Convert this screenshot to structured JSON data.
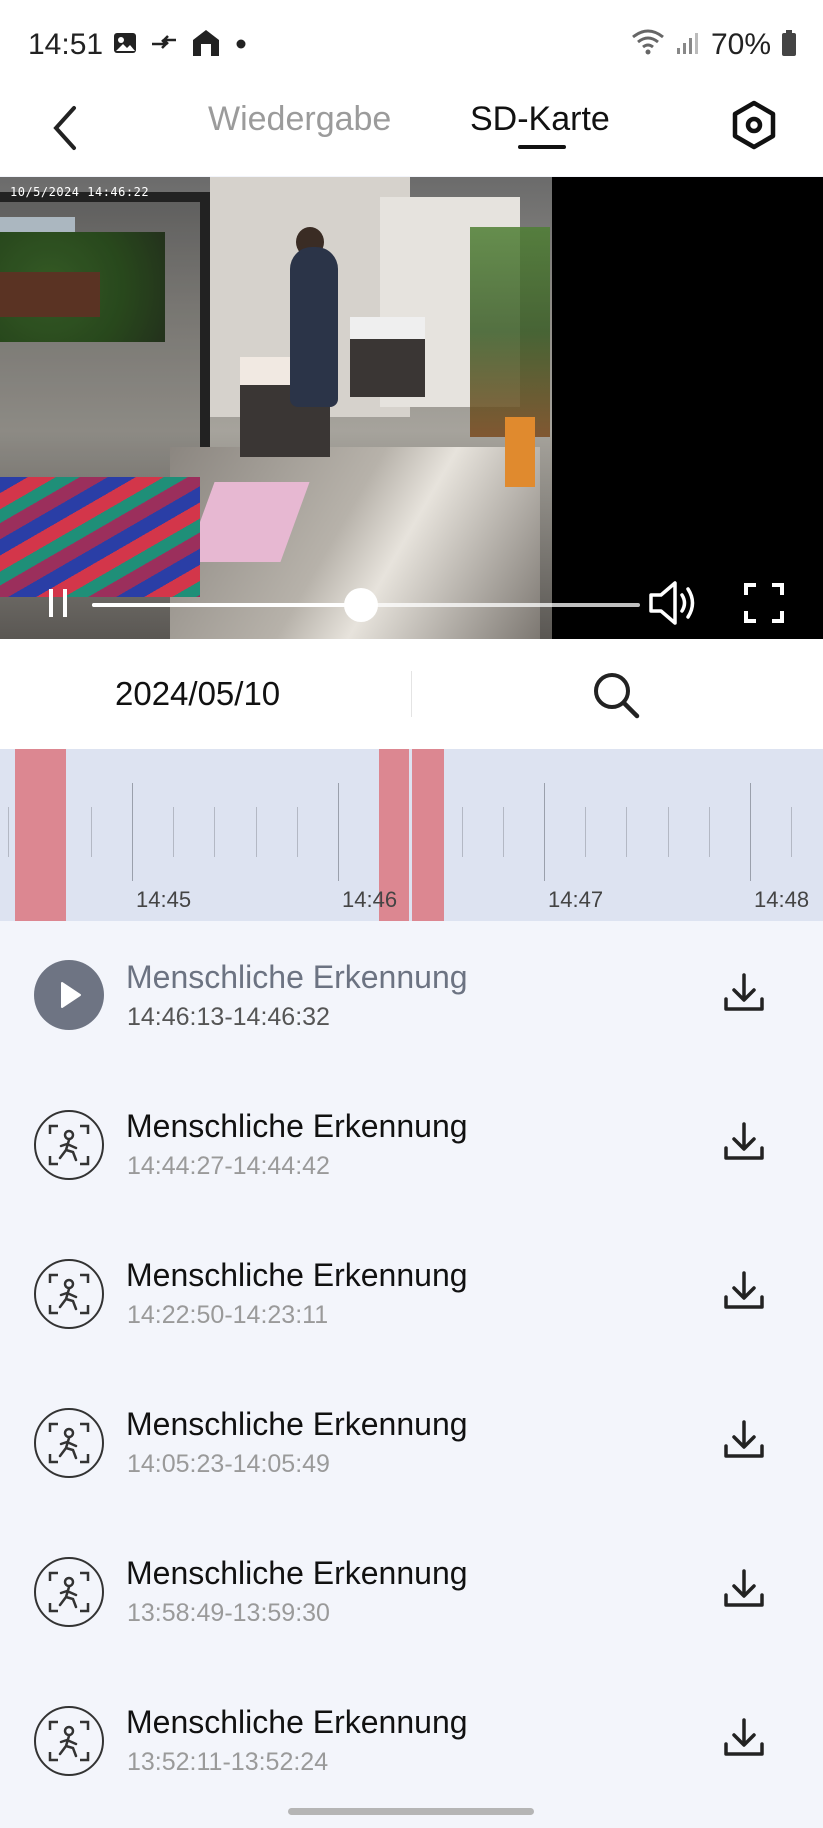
{
  "status_bar": {
    "time": "14:51",
    "battery": "70%",
    "icons": [
      "image-icon",
      "data-transfer-icon",
      "home-icon",
      "dot-icon",
      "wifi-icon",
      "signal-icon",
      "battery-icon"
    ]
  },
  "header": {
    "tabs": [
      {
        "label": "Wiedergabe",
        "active": false
      },
      {
        "label": "SD-Karte",
        "active": true
      }
    ],
    "back_icon": "chevron-left-icon",
    "settings_icon": "hexagon-settings-icon"
  },
  "video": {
    "osd_timestamp": "10/5/2024  14:46:22",
    "progress": 0.49,
    "controls": [
      "pause-icon",
      "volume-icon",
      "fullscreen-icon"
    ]
  },
  "date_bar": {
    "date": "2024/05/10",
    "search_icon": "search-icon"
  },
  "timeline": {
    "labels": [
      "14:45",
      "14:46",
      "14:47",
      "14:48"
    ]
  },
  "recordings": [
    {
      "title": "Menschliche Erkennung",
      "time": "14:46:13-14:46:32",
      "active": true,
      "icon": "play-icon"
    },
    {
      "title": "Menschliche Erkennung",
      "time": "14:44:27-14:44:42",
      "active": false,
      "icon": "human-detection-icon"
    },
    {
      "title": "Menschliche Erkennung",
      "time": "14:22:50-14:23:11",
      "active": false,
      "icon": "human-detection-icon"
    },
    {
      "title": "Menschliche Erkennung",
      "time": "14:05:23-14:05:49",
      "active": false,
      "icon": "human-detection-icon"
    },
    {
      "title": "Menschliche Erkennung",
      "time": "13:58:49-13:59:30",
      "active": false,
      "icon": "human-detection-icon"
    },
    {
      "title": "Menschliche Erkennung",
      "time": "13:52:11-13:52:24",
      "active": false,
      "icon": "human-detection-icon"
    }
  ],
  "colors": {
    "event_marker": "#dc8791",
    "timeline_bg": "#dde3f1",
    "list_bg": "#f3f5fb"
  }
}
